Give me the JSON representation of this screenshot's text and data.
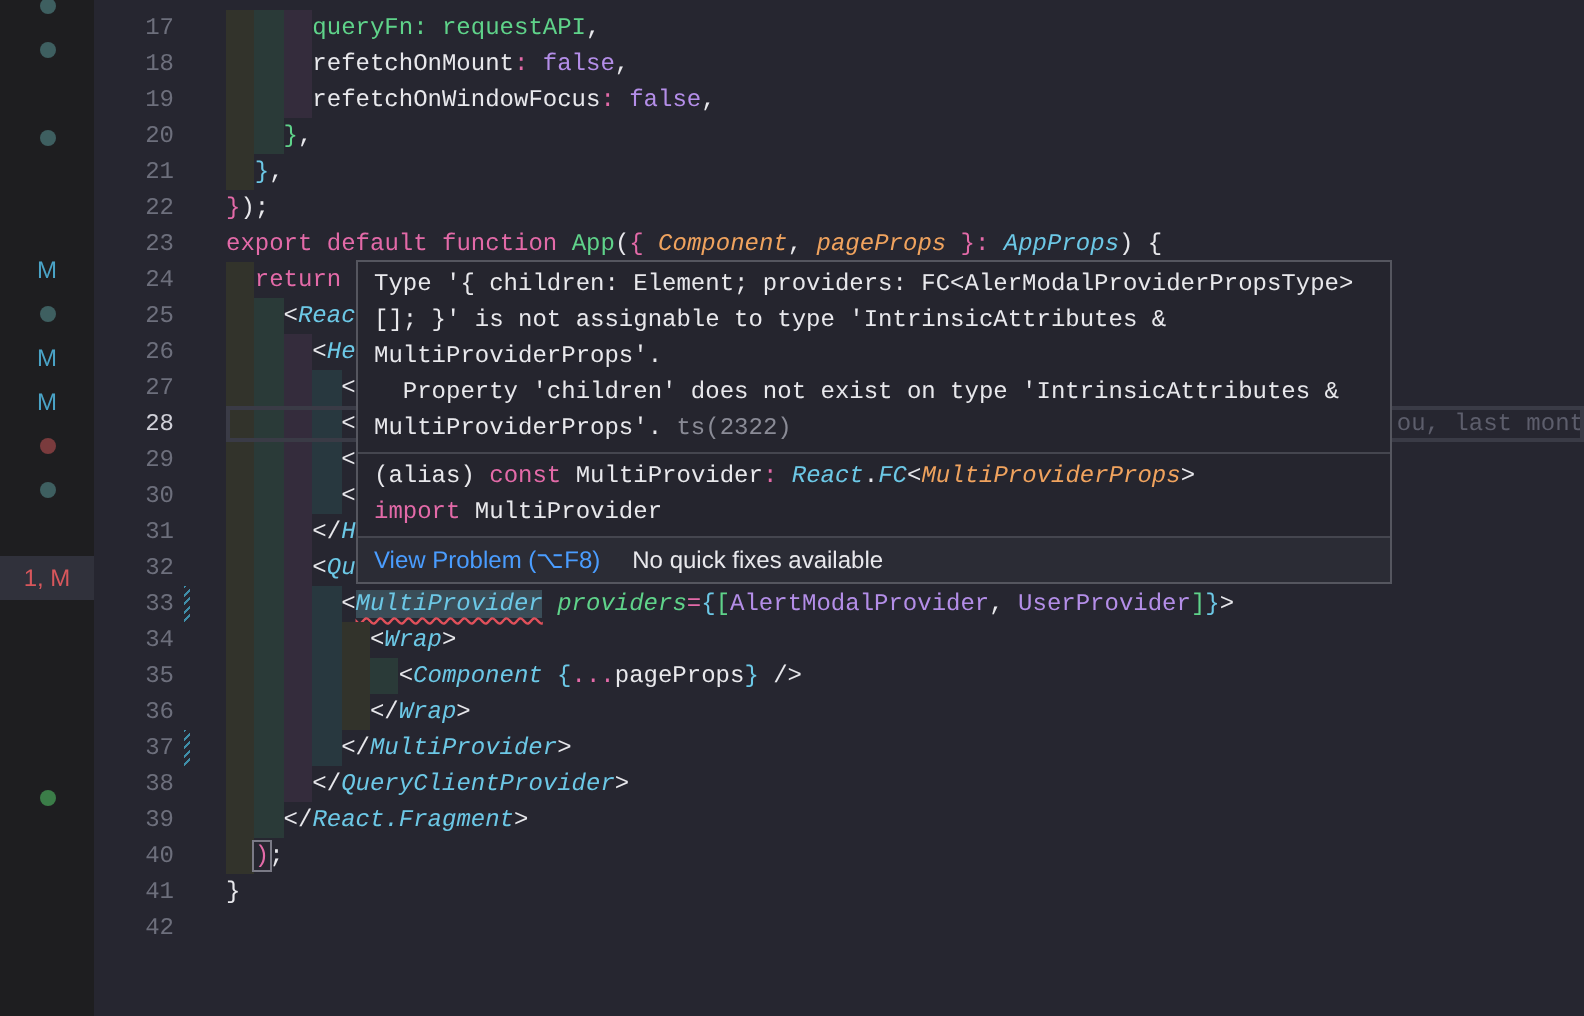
{
  "sidebar": {
    "rows": [
      {
        "selected": false,
        "mark": {
          "kind": "dot",
          "color": "#3e5f60"
        }
      },
      {
        "selected": false,
        "mark": {
          "kind": "dot",
          "color": "#3e5f60"
        }
      },
      {
        "mark": {
          "kind": "empty"
        }
      },
      {
        "selected": false,
        "mark": {
          "kind": "dot",
          "color": "#3e5f60"
        }
      },
      {
        "mark": {
          "kind": "empty"
        }
      },
      {
        "mark": {
          "kind": "empty"
        }
      },
      {
        "selected": false,
        "mark": {
          "kind": "text",
          "text": "M"
        }
      },
      {
        "selected": false,
        "mark": {
          "kind": "dot",
          "color": "#3e5f60"
        }
      },
      {
        "selected": false,
        "mark": {
          "kind": "text",
          "text": "M"
        }
      },
      {
        "selected": false,
        "mark": {
          "kind": "text",
          "text": "M"
        }
      },
      {
        "selected": false,
        "mark": {
          "kind": "dot",
          "color": "#7a3b3d"
        }
      },
      {
        "selected": false,
        "mark": {
          "kind": "dot",
          "color": "#3e5f60"
        }
      },
      {
        "mark": {
          "kind": "empty"
        }
      },
      {
        "selected": true,
        "mark": {
          "kind": "problem",
          "text": "1, M"
        }
      },
      {
        "mark": {
          "kind": "empty"
        }
      },
      {
        "mark": {
          "kind": "empty"
        }
      },
      {
        "mark": {
          "kind": "empty"
        }
      },
      {
        "mark": {
          "kind": "empty"
        }
      },
      {
        "selected": false,
        "mark": {
          "kind": "dot",
          "color": "#3b7d48"
        }
      }
    ]
  },
  "editor": {
    "lines": [
      {
        "number": "17",
        "current": false,
        "tokens": [
          {
            "text": "      queryFn: requestAPI",
            "kind": "fn"
          },
          {
            "text": ",",
            "kind": "plain"
          }
        ]
      },
      {
        "number": "18",
        "current": false,
        "tokens": [
          {
            "text": "      refetchOnMount",
            "kind": "plain"
          },
          {
            "text": ":",
            "kind": "op"
          },
          {
            "text": " false",
            "kind": "bool"
          },
          {
            "text": ",",
            "kind": "plain"
          }
        ]
      },
      {
        "number": "19",
        "current": false,
        "tokens": [
          {
            "text": "      refetchOnWindowFocus",
            "kind": "plain"
          },
          {
            "text": ":",
            "kind": "op"
          },
          {
            "text": " false",
            "kind": "bool"
          },
          {
            "text": ",",
            "kind": "plain"
          }
        ]
      },
      {
        "number": "20",
        "current": false,
        "tokens": [
          {
            "text": "    }",
            "kind": "brace-green"
          },
          {
            "text": ",",
            "kind": "plain"
          }
        ]
      },
      {
        "number": "21",
        "current": false,
        "tokens": [
          {
            "text": "  }",
            "kind": "brace-cyan"
          },
          {
            "text": ",",
            "kind": "plain"
          }
        ]
      },
      {
        "number": "22",
        "current": false,
        "tokens": [
          {
            "text": "}",
            "kind": "brace-pink"
          },
          {
            "text": ");",
            "kind": "plain"
          }
        ]
      },
      {
        "number": "23",
        "current": false,
        "tokens": [
          {
            "text": "export default function",
            "kind": "kw"
          },
          {
            "text": " App",
            "kind": "fn"
          },
          {
            "text": "(",
            "kind": "plain"
          },
          {
            "text": "{",
            "kind": "brace-pink"
          },
          {
            "text": " Component",
            "kind": "param"
          },
          {
            "text": ",",
            "kind": "plain"
          },
          {
            "text": " pageProps",
            "kind": "param"
          },
          {
            "text": " }:",
            "kind": "brace-pink"
          },
          {
            "text": " AppProps",
            "kind": "type"
          },
          {
            "text": ") {",
            "kind": "plain"
          }
        ]
      },
      {
        "number": "24",
        "current": false,
        "tokens": [
          {
            "text": "  return",
            "kind": "kw"
          }
        ]
      },
      {
        "number": "25",
        "current": false,
        "tokens": [
          {
            "text": "    <",
            "kind": "plain"
          },
          {
            "text": "Reac",
            "kind": "tag"
          }
        ]
      },
      {
        "number": "26",
        "current": false,
        "tokens": [
          {
            "text": "      <",
            "kind": "plain"
          },
          {
            "text": "He",
            "kind": "tag"
          }
        ]
      },
      {
        "number": "27",
        "current": false,
        "tokens": [
          {
            "text": "        <",
            "kind": "plain"
          }
        ]
      },
      {
        "number": "28",
        "current": true,
        "hint": "ou, last mont",
        "tokens": [
          {
            "text": "        <",
            "kind": "plain"
          }
        ]
      },
      {
        "number": "29",
        "current": false,
        "tokens": [
          {
            "text": "        <",
            "kind": "plain"
          }
        ]
      },
      {
        "number": "30",
        "current": false,
        "tokens": [
          {
            "text": "        <",
            "kind": "plain"
          }
        ]
      },
      {
        "number": "31",
        "current": false,
        "tokens": [
          {
            "text": "      </",
            "kind": "plain"
          },
          {
            "text": "H",
            "kind": "tag"
          }
        ]
      },
      {
        "number": "32",
        "current": false,
        "tokens": [
          {
            "text": "      <",
            "kind": "plain"
          },
          {
            "text": "Qu",
            "kind": "tag"
          }
        ]
      },
      {
        "number": "33",
        "current": false,
        "modified": true,
        "tokens": [
          {
            "text": "        <",
            "kind": "plain"
          },
          {
            "text": "MultiProvider",
            "kind": "tag-error"
          },
          {
            "text": " providers",
            "kind": "attr"
          },
          {
            "text": "=",
            "kind": "op"
          },
          {
            "text": "{",
            "kind": "brace-cyan"
          },
          {
            "text": "[",
            "kind": "brace-green"
          },
          {
            "text": "AlertModalProvider",
            "kind": "ident"
          },
          {
            "text": ",",
            "kind": "plain"
          },
          {
            "text": " UserProvider",
            "kind": "ident"
          },
          {
            "text": "]",
            "kind": "brace-green"
          },
          {
            "text": "}",
            "kind": "brace-cyan"
          },
          {
            "text": ">",
            "kind": "plain"
          }
        ]
      },
      {
        "number": "34",
        "current": false,
        "tokens": [
          {
            "text": "          <",
            "kind": "plain"
          },
          {
            "text": "Wrap",
            "kind": "tag"
          },
          {
            "text": ">",
            "kind": "plain"
          }
        ]
      },
      {
        "number": "35",
        "current": false,
        "tokens": [
          {
            "text": "            <",
            "kind": "plain"
          },
          {
            "text": "Component",
            "kind": "tag"
          },
          {
            "text": " {",
            "kind": "brace-cyan"
          },
          {
            "text": "...",
            "kind": "op"
          },
          {
            "text": "pageProps",
            "kind": "plain"
          },
          {
            "text": "}",
            "kind": "brace-cyan"
          },
          {
            "text": " />",
            "kind": "plain"
          }
        ]
      },
      {
        "number": "36",
        "current": false,
        "tokens": [
          {
            "text": "          </",
            "kind": "plain"
          },
          {
            "text": "Wrap",
            "kind": "tag"
          },
          {
            "text": ">",
            "kind": "plain"
          }
        ]
      },
      {
        "number": "37",
        "current": false,
        "modified": true,
        "tokens": [
          {
            "text": "        </",
            "kind": "plain"
          },
          {
            "text": "MultiProvider",
            "kind": "tag"
          },
          {
            "text": ">",
            "kind": "plain"
          }
        ]
      },
      {
        "number": "38",
        "current": false,
        "tokens": [
          {
            "text": "      </",
            "kind": "plain"
          },
          {
            "text": "QueryClientProvider",
            "kind": "tag"
          },
          {
            "text": ">",
            "kind": "plain"
          }
        ]
      },
      {
        "number": "39",
        "current": false,
        "tokens": [
          {
            "text": "    </",
            "kind": "plain"
          },
          {
            "text": "React.Fragment",
            "kind": "tag"
          },
          {
            "text": ">",
            "kind": "plain"
          }
        ]
      },
      {
        "number": "40",
        "current": false,
        "tokens": [
          {
            "text": "  )",
            "kind": "brace-match"
          },
          {
            "text": ";",
            "kind": "plain"
          }
        ]
      },
      {
        "number": "41",
        "current": false,
        "tokens": [
          {
            "text": "}",
            "kind": "plain"
          }
        ]
      },
      {
        "number": "42",
        "current": false
      }
    ]
  },
  "hover": {
    "message_lines": [
      "Type '{ children: Element; providers: FC<AlerModalProviderPropsType>",
      "[]; }' is not assignable to type 'IntrinsicAttributes &",
      "MultiProviderProps'.",
      "  Property 'children' does not exist on type 'IntrinsicAttributes &",
      "MultiProviderProps'."
    ],
    "error_code": "ts(2322)",
    "signature_lines": [
      [
        {
          "text": "(alias)",
          "kind": "plain"
        },
        {
          "text": " const",
          "kind": "kw"
        },
        {
          "text": " MultiProvider",
          "kind": "plain"
        },
        {
          "text": ":",
          "kind": "op"
        },
        {
          "text": " React",
          "kind": "type"
        },
        {
          "text": ".",
          "kind": "plain"
        },
        {
          "text": "FC",
          "kind": "type"
        },
        {
          "text": "<",
          "kind": "plain"
        },
        {
          "text": "MultiProviderProps",
          "kind": "param"
        },
        {
          "text": ">",
          "kind": "plain"
        }
      ],
      [
        {
          "text": "import",
          "kind": "kw"
        },
        {
          "text": " MultiProvider",
          "kind": "plain"
        }
      ]
    ],
    "actions": [
      {
        "kind": "link",
        "text": "View Problem (⌥F8)"
      },
      {
        "kind": "note",
        "text": "No quick fixes available"
      }
    ]
  }
}
